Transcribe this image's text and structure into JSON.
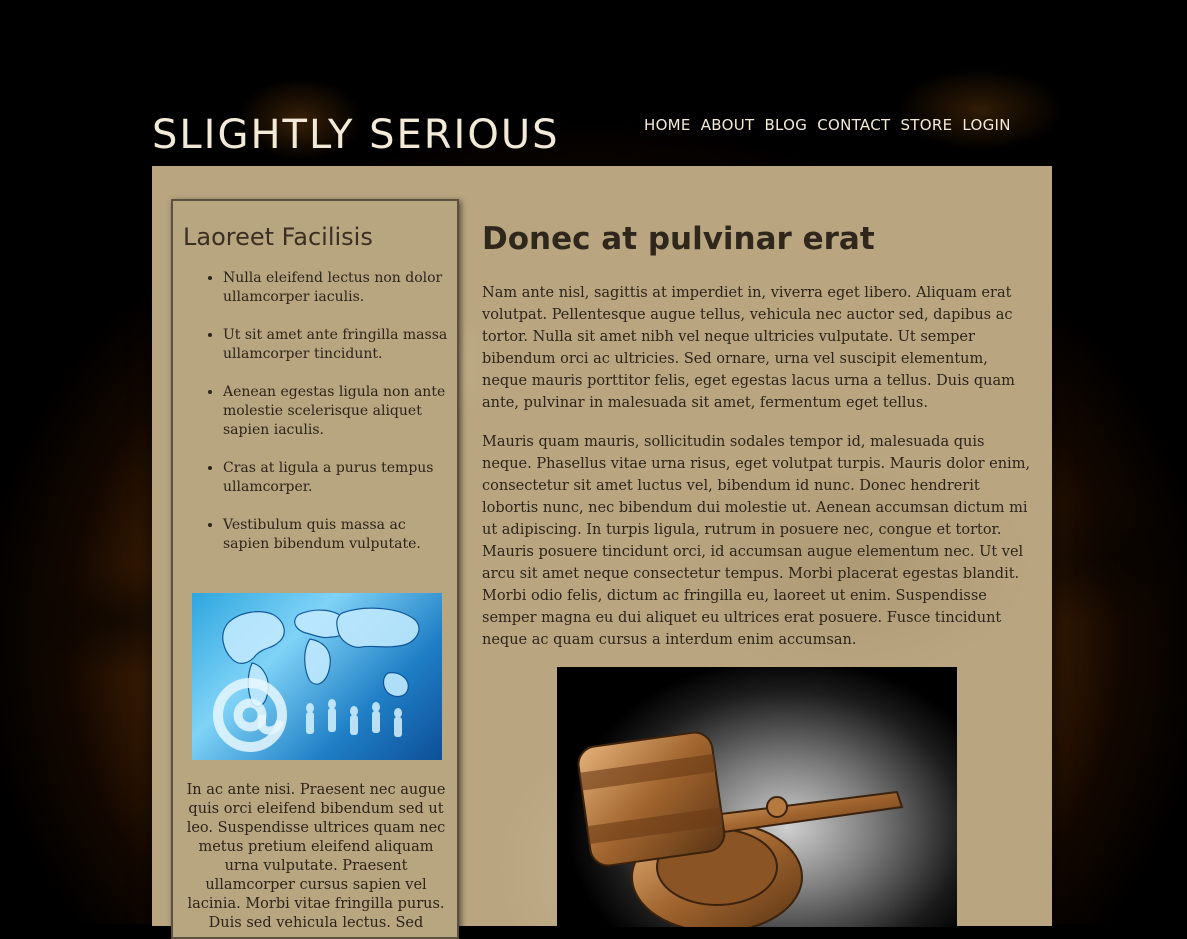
{
  "site": {
    "title": "SLIGHTLY SERIOUS"
  },
  "nav": {
    "items": [
      "HOME",
      "ABOUT",
      "BLOG",
      "CONTACT",
      "STORE",
      "LOGIN"
    ]
  },
  "sidebar": {
    "heading": "Laoreet Facilisis",
    "items": [
      "Nulla eleifend lectus non dolor ullamcorper iaculis.",
      "Ut sit amet ante fringilla massa ullamcorper tincidunt.",
      "Aenean egestas ligula non ante molestie scelerisque aliquet sapien iaculis.",
      "Cras at ligula a purus tempus ullamcorper.",
      "Vestibulum quis massa ac sapien bibendum vulputate."
    ],
    "image_icon": "world-map-network-image",
    "text": "In ac ante nisi. Praesent nec augue quis orci eleifend bibendum sed ut leo. Suspendisse ultrices quam nec metus pretium eleifend aliquam urna vulputate. Praesent ullamcorper cursus sapien vel lacinia. Morbi vitae fringilla purus. Duis sed vehicula lectus. Sed"
  },
  "main": {
    "title": "Donec at pulvinar erat",
    "paragraphs": [
      "Nam ante nisl, sagittis at imperdiet in, viverra eget libero. Aliquam erat volutpat. Pellentesque augue tellus, vehicula nec auctor sed, dapibus ac tortor. Nulla sit amet nibh vel neque ultricies vulputate. Ut semper bibendum orci ac ultricies. Sed ornare, urna vel suscipit elementum, neque mauris porttitor felis, eget egestas lacus urna a tellus. Duis quam ante, pulvinar in malesuada sit amet, fermentum eget tellus.",
      "Mauris quam mauris, sollicitudin sodales tempor id, malesuada quis neque. Phasellus vitae urna risus, eget volutpat turpis. Mauris dolor enim, consectetur sit amet luctus vel, bibendum id nunc. Donec hendrerit lobortis nunc, nec bibendum dui molestie ut. Aenean accumsan dictum mi ut adipiscing. In turpis ligula, rutrum in posuere nec, congue et tortor. Mauris posuere tincidunt orci, id accumsan augue elementum nec. Ut vel arcu sit amet neque consectetur tempus. Morbi placerat egestas blandit. Morbi odio felis, dictum ac fringilla eu, laoreet ut enim. Suspendisse semper magna eu dui aliquet eu ultrices erat posuere. Fusce tincidunt neque ac quam cursus a interdum enim accumsan."
    ],
    "image_icon": "gavel-image"
  },
  "colors": {
    "nav_text": "#f4ead8",
    "paper": "#b9a681",
    "heading_text": "#2f271c",
    "body_text": "#2c241a"
  }
}
